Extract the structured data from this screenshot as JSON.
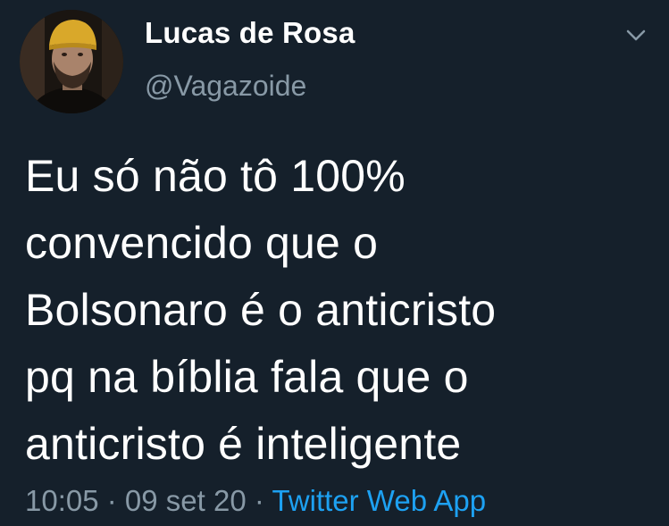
{
  "user": {
    "display_name": "Lucas de Rosa",
    "handle": "@Vagazoide"
  },
  "tweet": {
    "text": "Eu só não tô 100%\nconvencido que o\nBolsonaro é o anticristo\npq na bíblia fala que o\nanticristo é inteligente"
  },
  "meta": {
    "time": "10:05",
    "sep1": " · ",
    "date": "09 set 20",
    "sep2": " · ",
    "source": "Twitter Web App"
  },
  "icons": {
    "more": "chevron-down-icon"
  },
  "colors": {
    "background": "#15202b",
    "primary_text": "#ffffff",
    "secondary_text": "#8899a6",
    "link": "#1da1f2"
  }
}
